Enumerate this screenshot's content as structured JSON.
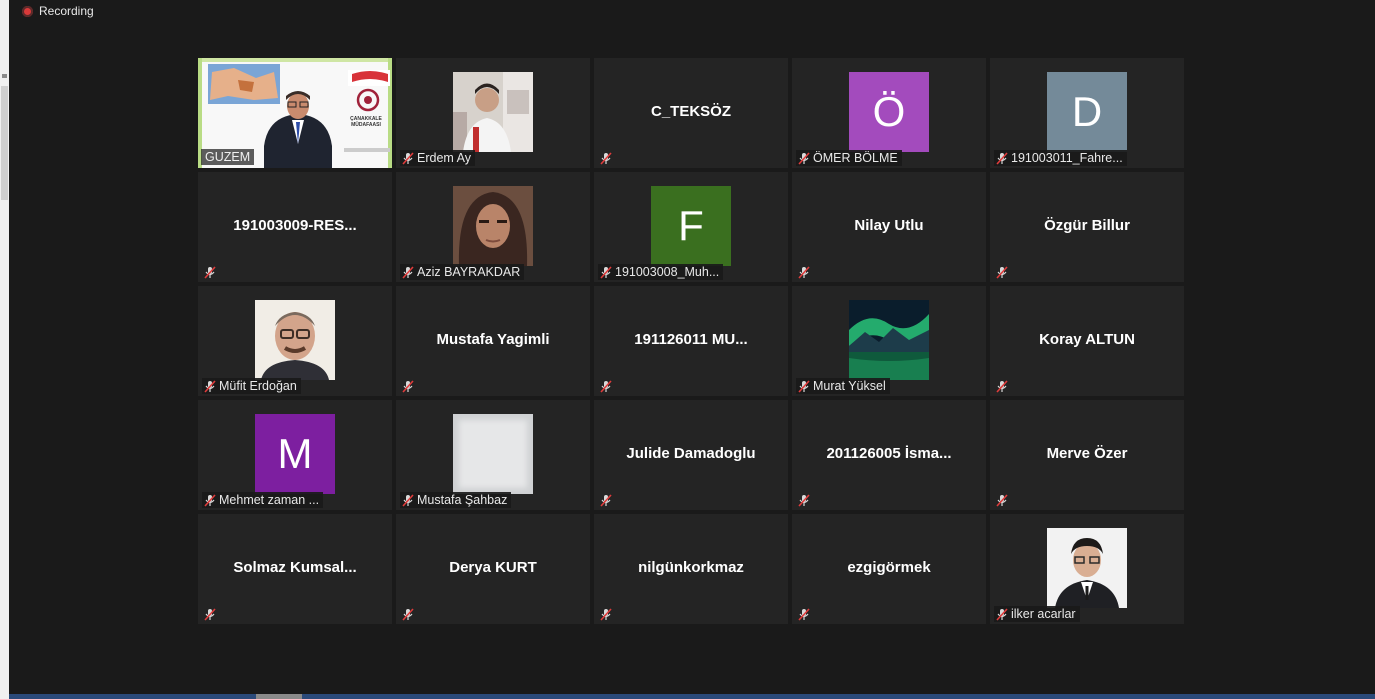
{
  "recording": {
    "label": "Recording"
  },
  "colors": {
    "active_outline": "#e5e680",
    "tile_bg": "#242424",
    "muted_icon": "#e03c3c"
  },
  "tiles": [
    {
      "type": "video",
      "name": "GUZEM",
      "active": true,
      "muted": false,
      "slide_text": "ÇANAKKALE MÜDAFAASI"
    },
    {
      "type": "photo",
      "name": "Erdem Ay",
      "muted": true,
      "photo": "man-in-white-shirt"
    },
    {
      "type": "text",
      "center": "C_TEKSÖZ",
      "muted": true
    },
    {
      "type": "letter",
      "letter": "Ö",
      "color": "#a34bbd",
      "name": "ÖMER BÖLME",
      "muted": true
    },
    {
      "type": "letter",
      "letter": "D",
      "color": "#748a99",
      "name": "191003011_Fahre...",
      "muted": true
    },
    {
      "type": "text",
      "center": "191003009-RES...",
      "muted": true
    },
    {
      "type": "photo",
      "name": "Aziz BAYRAKDAR",
      "muted": true,
      "photo": "woman-portrait"
    },
    {
      "type": "letter",
      "letter": "F",
      "color": "#3a6f1f",
      "name": "191003008_Muh...",
      "muted": true
    },
    {
      "type": "text",
      "center": "Nilay Utlu",
      "muted": true
    },
    {
      "type": "text",
      "center": "Özgür Billur",
      "muted": true
    },
    {
      "type": "photo",
      "name": "Müfit Erdoğan",
      "muted": true,
      "photo": "older-man-glasses"
    },
    {
      "type": "text",
      "center": "Mustafa Yagimli",
      "muted": true
    },
    {
      "type": "text",
      "center": "191126011 MU...",
      "muted": true
    },
    {
      "type": "photo",
      "name": "Murat Yüksel",
      "muted": true,
      "photo": "aurora-landscape"
    },
    {
      "type": "text",
      "center": "Koray ALTUN",
      "muted": true
    },
    {
      "type": "letter",
      "letter": "M",
      "color": "#7d1fa0",
      "name": "Mehmet zaman ...",
      "muted": true
    },
    {
      "type": "photo",
      "name": "Mustafa Şahbaz",
      "muted": true,
      "photo": "blurred"
    },
    {
      "type": "text",
      "center": "Julide Damadoglu",
      "muted": true
    },
    {
      "type": "text",
      "center": "201126005 İsma...",
      "muted": true
    },
    {
      "type": "text",
      "center": "Merve Özer",
      "muted": true
    },
    {
      "type": "text",
      "center": "Solmaz  Kumsal...",
      "muted": true
    },
    {
      "type": "text",
      "center": "Derya KURT",
      "muted": true
    },
    {
      "type": "text",
      "center": "nilgünkorkmaz",
      "muted": true
    },
    {
      "type": "text",
      "center": "ezgigörmek",
      "muted": true
    },
    {
      "type": "photo",
      "name": "ilker acarlar",
      "muted": true,
      "photo": "man-in-suit"
    }
  ]
}
